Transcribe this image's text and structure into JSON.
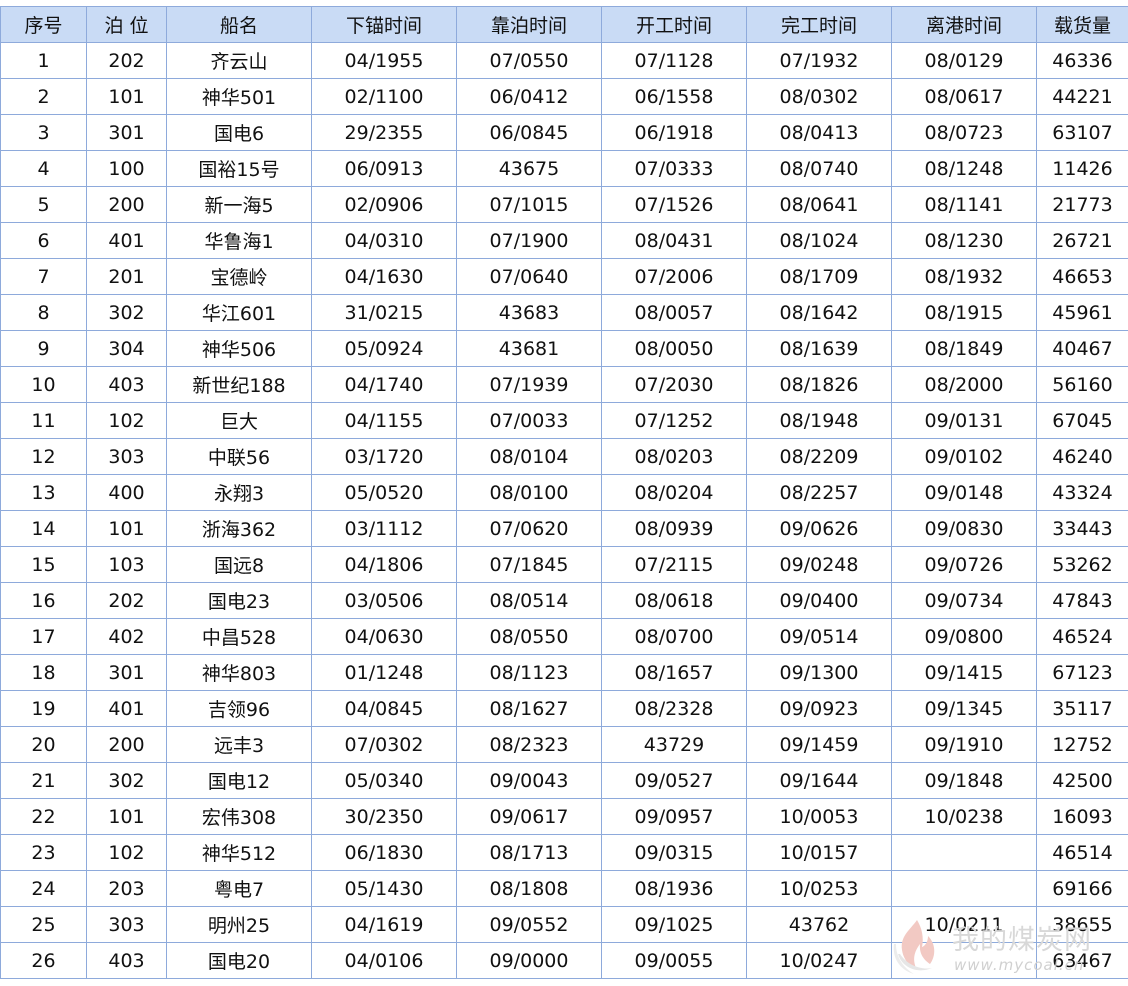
{
  "table": {
    "headers": [
      "序号",
      "泊 位",
      "船名",
      "下锚时间",
      "靠泊时间",
      "开工时间",
      "完工时间",
      "离港时间",
      "载货量"
    ],
    "rows": [
      [
        "1",
        "202",
        "齐云山",
        "04/1955",
        "07/0550",
        "07/1128",
        "07/1932",
        "08/0129",
        "46336"
      ],
      [
        "2",
        "101",
        "神华501",
        "02/1100",
        "06/0412",
        "06/1558",
        "08/0302",
        "08/0617",
        "44221"
      ],
      [
        "3",
        "301",
        "国电6",
        "29/2355",
        "06/0845",
        "06/1918",
        "08/0413",
        "08/0723",
        "63107"
      ],
      [
        "4",
        "100",
        "国裕15号",
        "06/0913",
        "43675",
        "07/0333",
        "08/0740",
        "08/1248",
        "11426"
      ],
      [
        "5",
        "200",
        "新一海5",
        "02/0906",
        "07/1015",
        "07/1526",
        "08/0641",
        "08/1141",
        "21773"
      ],
      [
        "6",
        "401",
        "华鲁海1",
        "04/0310",
        "07/1900",
        "08/0431",
        "08/1024",
        "08/1230",
        "26721"
      ],
      [
        "7",
        "201",
        "宝德岭",
        "04/1630",
        "07/0640",
        "07/2006",
        "08/1709",
        "08/1932",
        "46653"
      ],
      [
        "8",
        "302",
        "华江601",
        "31/0215",
        "43683",
        "08/0057",
        "08/1642",
        "08/1915",
        "45961"
      ],
      [
        "9",
        "304",
        "神华506",
        "05/0924",
        "43681",
        "08/0050",
        "08/1639",
        "08/1849",
        "40467"
      ],
      [
        "10",
        "403",
        "新世纪188",
        "04/1740",
        "07/1939",
        "07/2030",
        "08/1826",
        "08/2000",
        "56160"
      ],
      [
        "11",
        "102",
        "巨大",
        "04/1155",
        "07/0033",
        "07/1252",
        "08/1948",
        "09/0131",
        "67045"
      ],
      [
        "12",
        "303",
        "中联56",
        "03/1720",
        "08/0104",
        "08/0203",
        "08/2209",
        "09/0102",
        "46240"
      ],
      [
        "13",
        "400",
        "永翔3",
        "05/0520",
        "08/0100",
        "08/0204",
        "08/2257",
        "09/0148",
        "43324"
      ],
      [
        "14",
        "101",
        "浙海362",
        "03/1112",
        "07/0620",
        "08/0939",
        "09/0626",
        "09/0830",
        "33443"
      ],
      [
        "15",
        "103",
        "国远8",
        "04/1806",
        "07/1845",
        "07/2115",
        "09/0248",
        "09/0726",
        "53262"
      ],
      [
        "16",
        "202",
        "国电23",
        "03/0506",
        "08/0514",
        "08/0618",
        "09/0400",
        "09/0734",
        "47843"
      ],
      [
        "17",
        "402",
        "中昌528",
        "04/0630",
        "08/0550",
        "08/0700",
        "09/0514",
        "09/0800",
        "46524"
      ],
      [
        "18",
        "301",
        "神华803",
        "01/1248",
        "08/1123",
        "08/1657",
        "09/1300",
        "09/1415",
        "67123"
      ],
      [
        "19",
        "401",
        "吉领96",
        "04/0845",
        "08/1627",
        "08/2328",
        "09/0923",
        "09/1345",
        "35117"
      ],
      [
        "20",
        "200",
        "远丰3",
        "07/0302",
        "08/2323",
        "43729",
        "09/1459",
        "09/1910",
        "12752"
      ],
      [
        "21",
        "302",
        "国电12",
        "05/0340",
        "09/0043",
        "09/0527",
        "09/1644",
        "09/1848",
        "42500"
      ],
      [
        "22",
        "101",
        "宏伟308",
        "30/2350",
        "09/0617",
        "09/0957",
        "10/0053",
        "10/0238",
        "16093"
      ],
      [
        "23",
        "102",
        "神华512",
        "06/1830",
        "08/1713",
        "09/0315",
        "10/0157",
        "",
        "46514"
      ],
      [
        "24",
        "203",
        "粤电7",
        "05/1430",
        "08/1808",
        "08/1936",
        "10/0253",
        "",
        "69166"
      ],
      [
        "25",
        "303",
        "明州25",
        "04/1619",
        "09/0552",
        "09/1025",
        "43762",
        "10/0211",
        "38655"
      ],
      [
        "26",
        "403",
        "国电20",
        "04/0106",
        "09/0000",
        "09/0055",
        "10/0247",
        "",
        "63467"
      ]
    ]
  },
  "watermark": {
    "title": "我的煤炭网",
    "url": "www.mycoal.cn",
    "logo_icon": "flame-logo-icon",
    "color": "#d8d8d8"
  }
}
